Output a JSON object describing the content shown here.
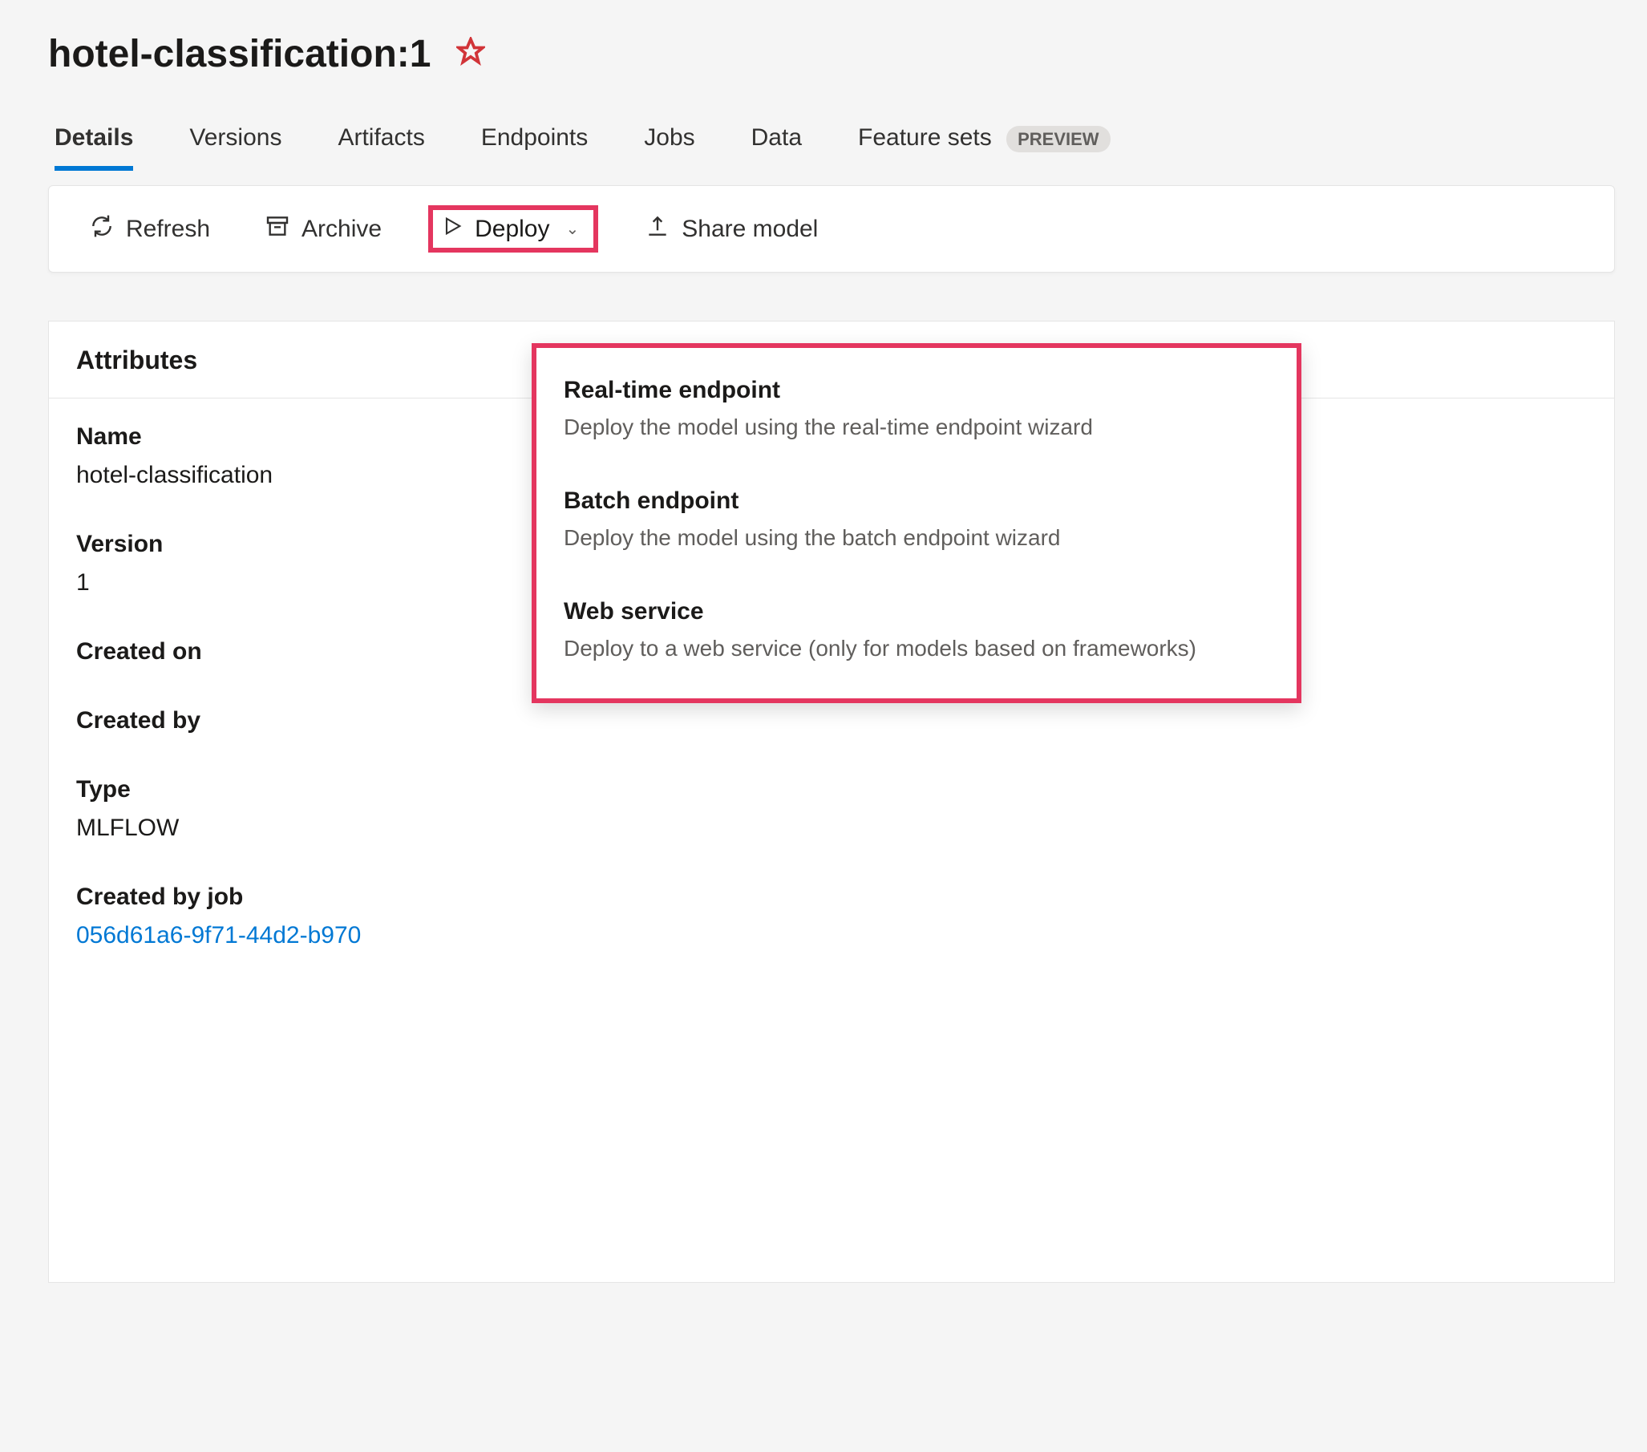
{
  "header": {
    "title": "hotel-classification:1"
  },
  "tabs": [
    {
      "label": "Details",
      "active": true
    },
    {
      "label": "Versions"
    },
    {
      "label": "Artifacts"
    },
    {
      "label": "Endpoints"
    },
    {
      "label": "Jobs"
    },
    {
      "label": "Data"
    },
    {
      "label": "Feature sets",
      "badge": "PREVIEW"
    }
  ],
  "toolbar": {
    "refresh_label": "Refresh",
    "archive_label": "Archive",
    "deploy_label": "Deploy",
    "share_label": "Share model"
  },
  "deploy_menu": [
    {
      "title": "Real-time endpoint",
      "desc": "Deploy the model using the real-time endpoint wizard"
    },
    {
      "title": "Batch endpoint",
      "desc": "Deploy the model using the batch endpoint wizard"
    },
    {
      "title": "Web service",
      "desc": "Deploy to a web service (only for models based on frameworks)"
    }
  ],
  "attributes": {
    "section_title": "Attributes",
    "name_label": "Name",
    "name_value": "hotel-classification",
    "version_label": "Version",
    "version_value": "1",
    "created_on_label": "Created on",
    "created_on_value": "",
    "created_by_label": "Created by",
    "created_by_value": "",
    "type_label": "Type",
    "type_value": "MLFLOW",
    "created_by_job_label": "Created by job",
    "created_by_job_value": "056d61a6-9f71-44d2-b970"
  }
}
